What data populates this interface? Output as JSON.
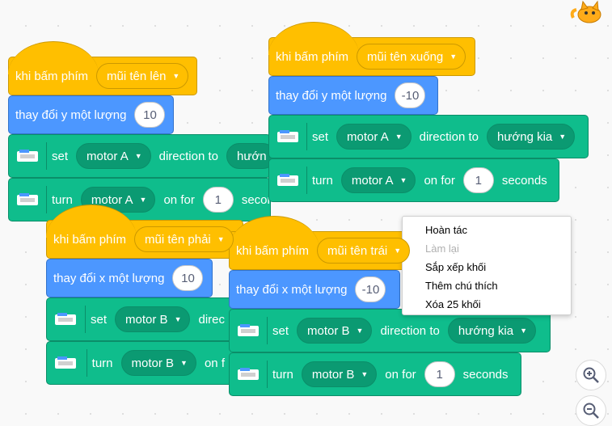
{
  "scripts": [
    {
      "hat": {
        "label": "khi bấm phím",
        "key": "mũi tên lên"
      },
      "motion": {
        "label": "thay đổi y một lượng",
        "value": "10"
      },
      "set": {
        "label": "set",
        "motor": "motor A",
        "mid": "direction to",
        "dir": "hướn"
      },
      "turn": {
        "label": "turn",
        "motor": "motor A",
        "mid": "on for",
        "value": "1",
        "unit": "secon"
      }
    },
    {
      "hat": {
        "label": "khi bấm phím",
        "key": "mũi tên xuống"
      },
      "motion": {
        "label": "thay đổi y một lượng",
        "value": "-10"
      },
      "set": {
        "label": "set",
        "motor": "motor A",
        "mid": "direction to",
        "dir": "hướng kia"
      },
      "turn": {
        "label": "turn",
        "motor": "motor A",
        "mid": "on for",
        "value": "1",
        "unit": "seconds"
      }
    },
    {
      "hat": {
        "label": "khi bấm phím",
        "key": "mũi tên phải"
      },
      "motion": {
        "label": "thay đổi x một lượng",
        "value": "10"
      },
      "set": {
        "label": "set",
        "motor": "motor B",
        "mid": "direc"
      },
      "turn": {
        "label": "turn",
        "motor": "motor B",
        "mid": "on f"
      }
    },
    {
      "hat": {
        "label": "khi bấm phím",
        "key": "mũi tên trái"
      },
      "motion": {
        "label": "thay đổi x một lượng",
        "value": "-10"
      },
      "set": {
        "label": "set",
        "motor": "motor B",
        "mid": "direction to",
        "dir": "hướng kia"
      },
      "turn": {
        "label": "turn",
        "motor": "motor B",
        "mid": "on for",
        "value": "1",
        "unit": "seconds"
      }
    }
  ],
  "context_menu": {
    "items": [
      "Hoàn tác",
      "Làm lại",
      "Sắp xếp khối",
      "Thêm chú thích",
      "Xóa 25 khối"
    ],
    "disabled": [
      false,
      true,
      false,
      false,
      false
    ]
  },
  "icons": {
    "sprite": "cat-sprite-icon",
    "zoom_in": "zoom-in-icon",
    "zoom_out": "zoom-out-icon",
    "motor": "motor-extension-icon"
  },
  "colors": {
    "events": "#ffbf00",
    "motion": "#4c97ff",
    "extension": "#0fbd8c"
  }
}
